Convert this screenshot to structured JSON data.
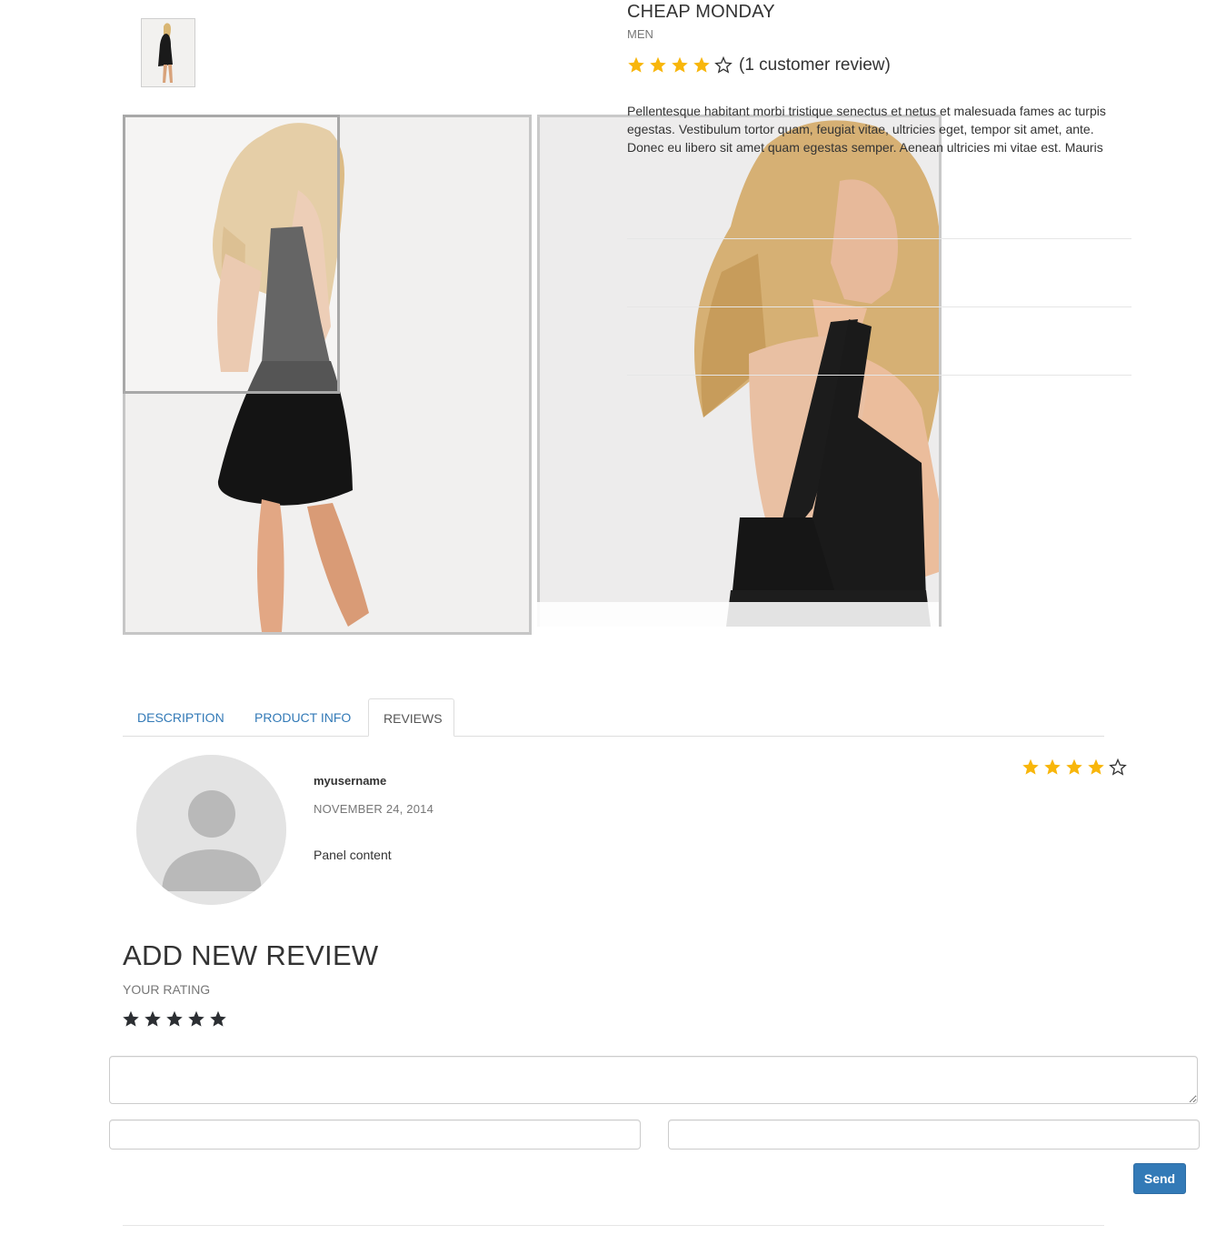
{
  "product": {
    "brand": "CHEAP MONDAY",
    "category": "MEN",
    "rating": {
      "value": 4,
      "max": 5
    },
    "review_count_label": "(1 customer review)",
    "description": "Pellentesque habitant morbi tristique senectus et netus et malesuada fames ac turpis egestas. Vestibulum tortor quam, feugiat vitae, ultricies eget, tempor sit amet, ante. Donec eu libero sit amet quam egestas semper. Aenean ultricies mi vitae est. Mauris",
    "images": {
      "thumbnail": "product-thumbnail",
      "main": "product-main-photo",
      "zoom": "product-zoom-view"
    }
  },
  "tabs": [
    {
      "label": "DESCRIPTION",
      "active": false
    },
    {
      "label": "PRODUCT INFO",
      "active": false
    },
    {
      "label": "REVIEWS",
      "active": true
    }
  ],
  "review": {
    "username": "myusername",
    "date": "NOVEMBER 24, 2014",
    "body": "Panel content",
    "rating": {
      "value": 4,
      "max": 5
    },
    "avatar_icon": "user-placeholder-icon"
  },
  "add_review": {
    "title": "ADD NEW REVIEW",
    "rating_label": "YOUR RATING",
    "rating_stars": 5,
    "comment_placeholder": "",
    "name_placeholder": "",
    "email_placeholder": "",
    "send_label": "Send"
  },
  "colors": {
    "star_filled": "#f8b60b",
    "star_input": "#2c2f33",
    "link": "#337ab7",
    "button": "#337ab7"
  }
}
